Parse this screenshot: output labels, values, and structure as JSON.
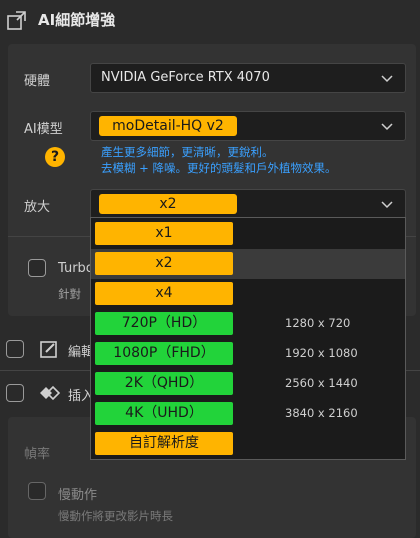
{
  "header": {
    "title": "AI細節增強",
    "icon": "external-expand-icon"
  },
  "gpu": {
    "label": "硬體",
    "value": "NVIDIA GeForce RTX 4070"
  },
  "model": {
    "label": "AI模型",
    "value": "moDetail-HQ  v2",
    "description_line1": "產生更多細節，更清晰，更銳利。",
    "description_line2": "去模糊 + 降噪。更好的頭髮和戶外植物效果。",
    "help": "?"
  },
  "scale": {
    "label": "放大",
    "value": "x2"
  },
  "turbo": {
    "label": "Turbo",
    "sublabel": "針對"
  },
  "section_edit": {
    "label": "編輯"
  },
  "section_insert": {
    "label": "插入"
  },
  "frame": {
    "label": "幀率",
    "slowmo_label": "慢動作",
    "slowmo_sub": "慢動作將更改影片時長"
  },
  "dropdown_options": [
    {
      "label": "x1",
      "res": "",
      "color": "#ffb400"
    },
    {
      "label": "x2",
      "res": "",
      "color": "#ffb400",
      "selected": true
    },
    {
      "label": "x4",
      "res": "",
      "color": "#ffb400"
    },
    {
      "label": "720P（HD）",
      "res": "1280 x 720",
      "color": "#22d33a"
    },
    {
      "label": "1080P（FHD）",
      "res": "1920 x 1080",
      "color": "#22d33a"
    },
    {
      "label": "2K（QHD）",
      "res": "2560 x 1440",
      "color": "#22d33a"
    },
    {
      "label": "4K（UHD）",
      "res": "3840 x 2160",
      "color": "#22d33a"
    },
    {
      "label": "自訂解析度",
      "res": "",
      "color": "#ffb400"
    }
  ]
}
